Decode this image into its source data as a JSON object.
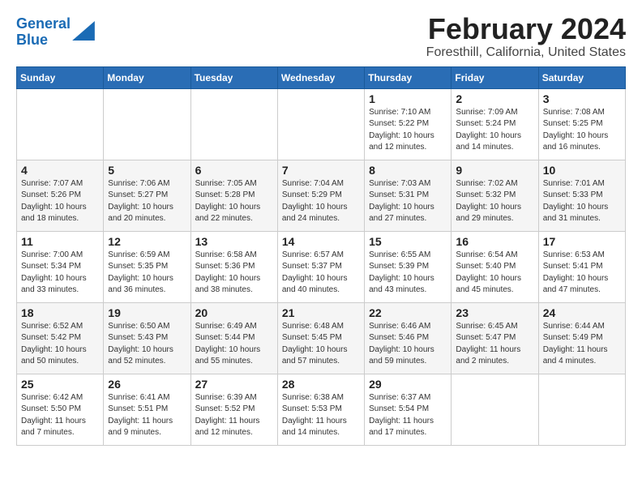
{
  "app": {
    "logo_line1": "General",
    "logo_line2": "Blue"
  },
  "calendar": {
    "title": "February 2024",
    "subtitle": "Foresthill, California, United States",
    "days_of_week": [
      "Sunday",
      "Monday",
      "Tuesday",
      "Wednesday",
      "Thursday",
      "Friday",
      "Saturday"
    ],
    "weeks": [
      [
        {
          "day": "",
          "info": ""
        },
        {
          "day": "",
          "info": ""
        },
        {
          "day": "",
          "info": ""
        },
        {
          "day": "",
          "info": ""
        },
        {
          "day": "1",
          "info": "Sunrise: 7:10 AM\nSunset: 5:22 PM\nDaylight: 10 hours\nand 12 minutes."
        },
        {
          "day": "2",
          "info": "Sunrise: 7:09 AM\nSunset: 5:24 PM\nDaylight: 10 hours\nand 14 minutes."
        },
        {
          "day": "3",
          "info": "Sunrise: 7:08 AM\nSunset: 5:25 PM\nDaylight: 10 hours\nand 16 minutes."
        }
      ],
      [
        {
          "day": "4",
          "info": "Sunrise: 7:07 AM\nSunset: 5:26 PM\nDaylight: 10 hours\nand 18 minutes."
        },
        {
          "day": "5",
          "info": "Sunrise: 7:06 AM\nSunset: 5:27 PM\nDaylight: 10 hours\nand 20 minutes."
        },
        {
          "day": "6",
          "info": "Sunrise: 7:05 AM\nSunset: 5:28 PM\nDaylight: 10 hours\nand 22 minutes."
        },
        {
          "day": "7",
          "info": "Sunrise: 7:04 AM\nSunset: 5:29 PM\nDaylight: 10 hours\nand 24 minutes."
        },
        {
          "day": "8",
          "info": "Sunrise: 7:03 AM\nSunset: 5:31 PM\nDaylight: 10 hours\nand 27 minutes."
        },
        {
          "day": "9",
          "info": "Sunrise: 7:02 AM\nSunset: 5:32 PM\nDaylight: 10 hours\nand 29 minutes."
        },
        {
          "day": "10",
          "info": "Sunrise: 7:01 AM\nSunset: 5:33 PM\nDaylight: 10 hours\nand 31 minutes."
        }
      ],
      [
        {
          "day": "11",
          "info": "Sunrise: 7:00 AM\nSunset: 5:34 PM\nDaylight: 10 hours\nand 33 minutes."
        },
        {
          "day": "12",
          "info": "Sunrise: 6:59 AM\nSunset: 5:35 PM\nDaylight: 10 hours\nand 36 minutes."
        },
        {
          "day": "13",
          "info": "Sunrise: 6:58 AM\nSunset: 5:36 PM\nDaylight: 10 hours\nand 38 minutes."
        },
        {
          "day": "14",
          "info": "Sunrise: 6:57 AM\nSunset: 5:37 PM\nDaylight: 10 hours\nand 40 minutes."
        },
        {
          "day": "15",
          "info": "Sunrise: 6:55 AM\nSunset: 5:39 PM\nDaylight: 10 hours\nand 43 minutes."
        },
        {
          "day": "16",
          "info": "Sunrise: 6:54 AM\nSunset: 5:40 PM\nDaylight: 10 hours\nand 45 minutes."
        },
        {
          "day": "17",
          "info": "Sunrise: 6:53 AM\nSunset: 5:41 PM\nDaylight: 10 hours\nand 47 minutes."
        }
      ],
      [
        {
          "day": "18",
          "info": "Sunrise: 6:52 AM\nSunset: 5:42 PM\nDaylight: 10 hours\nand 50 minutes."
        },
        {
          "day": "19",
          "info": "Sunrise: 6:50 AM\nSunset: 5:43 PM\nDaylight: 10 hours\nand 52 minutes."
        },
        {
          "day": "20",
          "info": "Sunrise: 6:49 AM\nSunset: 5:44 PM\nDaylight: 10 hours\nand 55 minutes."
        },
        {
          "day": "21",
          "info": "Sunrise: 6:48 AM\nSunset: 5:45 PM\nDaylight: 10 hours\nand 57 minutes."
        },
        {
          "day": "22",
          "info": "Sunrise: 6:46 AM\nSunset: 5:46 PM\nDaylight: 10 hours\nand 59 minutes."
        },
        {
          "day": "23",
          "info": "Sunrise: 6:45 AM\nSunset: 5:47 PM\nDaylight: 11 hours\nand 2 minutes."
        },
        {
          "day": "24",
          "info": "Sunrise: 6:44 AM\nSunset: 5:49 PM\nDaylight: 11 hours\nand 4 minutes."
        }
      ],
      [
        {
          "day": "25",
          "info": "Sunrise: 6:42 AM\nSunset: 5:50 PM\nDaylight: 11 hours\nand 7 minutes."
        },
        {
          "day": "26",
          "info": "Sunrise: 6:41 AM\nSunset: 5:51 PM\nDaylight: 11 hours\nand 9 minutes."
        },
        {
          "day": "27",
          "info": "Sunrise: 6:39 AM\nSunset: 5:52 PM\nDaylight: 11 hours\nand 12 minutes."
        },
        {
          "day": "28",
          "info": "Sunrise: 6:38 AM\nSunset: 5:53 PM\nDaylight: 11 hours\nand 14 minutes."
        },
        {
          "day": "29",
          "info": "Sunrise: 6:37 AM\nSunset: 5:54 PM\nDaylight: 11 hours\nand 17 minutes."
        },
        {
          "day": "",
          "info": ""
        },
        {
          "day": "",
          "info": ""
        }
      ]
    ]
  }
}
